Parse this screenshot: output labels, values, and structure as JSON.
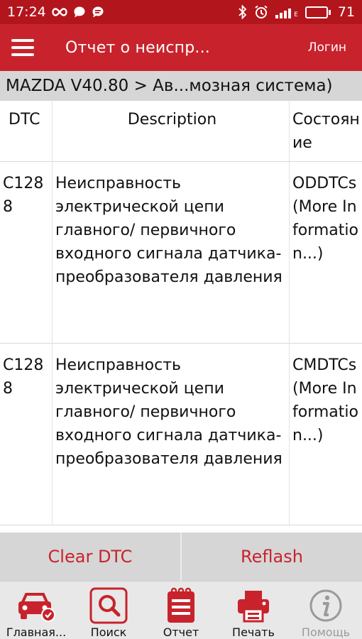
{
  "status_bar": {
    "time": "17:24",
    "battery": "71",
    "network_label": "E"
  },
  "toolbar": {
    "title": "Отчет о неиспр...",
    "login_label": "Логин"
  },
  "breadcrumb": "MAZDA V40.80 > Ав...мозная система)",
  "table": {
    "headers": {
      "code": "DTC",
      "description": "Description",
      "state": "Состояние"
    },
    "rows": [
      {
        "code": "C1288",
        "description": "Неисправность электрической цепи главного/ первичного входного сигнала датчика-преобразователя давления",
        "state": "ODDTCs(More Information...)"
      },
      {
        "code": "C1288",
        "description": "Неисправность электрической цепи главного/ первичного входного сигнала датчика-преобразователя давления",
        "state": "CMDTCs(More Information...)"
      }
    ]
  },
  "actions": {
    "clear_label": "Clear DTC",
    "reflash_label": "Reflash"
  },
  "bottom_nav": {
    "items": [
      {
        "label": "Главная...",
        "icon": "car-check-icon"
      },
      {
        "label": "Поиск",
        "icon": "search-icon"
      },
      {
        "label": "Отчет",
        "icon": "report-icon"
      },
      {
        "label": "Печать",
        "icon": "printer-icon"
      },
      {
        "label": "Помощь",
        "icon": "info-icon"
      }
    ]
  },
  "colors": {
    "brand_red": "#c8232c",
    "status_red": "#b3151d",
    "gray_bar": "#d6d6d6",
    "disabled": "#9a9a9a"
  }
}
